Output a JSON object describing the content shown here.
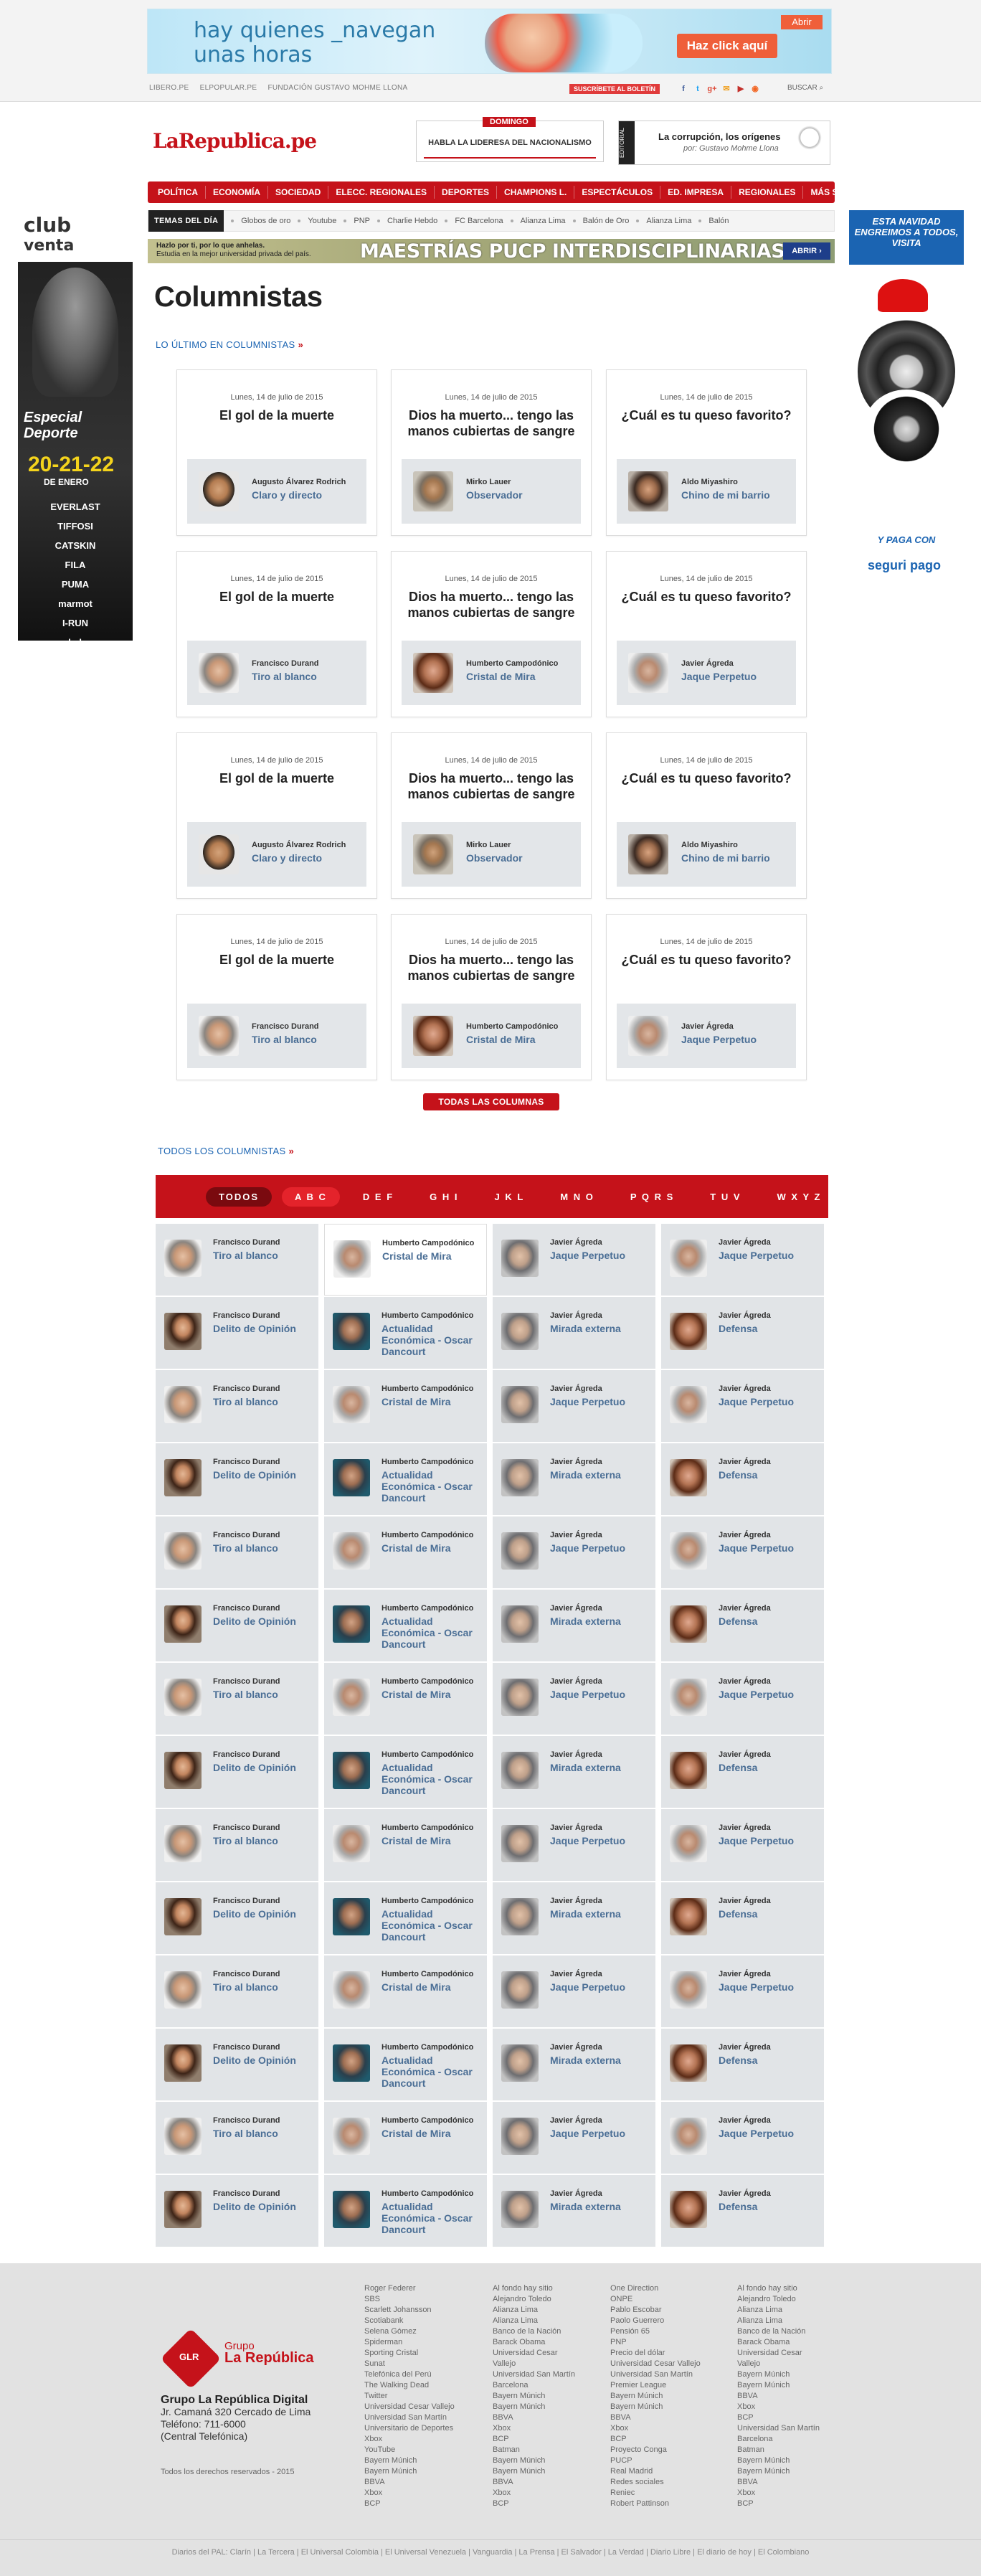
{
  "ad_top": {
    "line1": "hay quienes _navegan",
    "line2": "unas horas",
    "cta": "Haz click aquí",
    "open": "Abrir"
  },
  "top_links": [
    "LIBERO.PE",
    "ELPOPULAR.PE",
    "FUNDACIÓN GUSTAVO MOHME LLONA"
  ],
  "subscribe": "SUSCRÍBETE AL BOLETÍN",
  "search": "BUSCAR",
  "logo": "LaRepublica.pe",
  "domingo": {
    "tag": "DOMINGO",
    "text": "HABLA LA LIDERESA DEL NACIONALISMO"
  },
  "promo": {
    "side": "EDITORIAL",
    "title": "La corrupción, los orígenes",
    "subtitle": "por: Gustavo Mohme Llona"
  },
  "nav": [
    "POLÍTICA",
    "ECONOMÍA",
    "SOCIEDAD",
    "ELECC. REGIONALES",
    "DEPORTES",
    "CHAMPIONS L.",
    "ESPECTÁCULOS",
    "ED. IMPRESA",
    "REGIONALES",
    "MÁS SECCIONES ›"
  ],
  "temas": {
    "label": "TEMAS DEL DÍA",
    "items": [
      "Globos de oro",
      "Youtube",
      "PNP",
      "Charlie Hebdo",
      "FC Barcelona",
      "Alianza Lima",
      "Balón de Oro",
      "Alianza Lima",
      "Balón"
    ]
  },
  "maestrias": {
    "small1": "Hazlo por ti, por lo que anhelas.",
    "small2": "Estudia en la mejor universidad privada del país.",
    "big": "MAESTRÍAS PUCP INTERDISCIPLINARIAS",
    "btn": "ABRIR ›"
  },
  "ad_left": {
    "club": "club",
    "venta": "venta",
    "esp1": "Especial",
    "esp2": "Deporte",
    "date": "20-21-22",
    "ene": "DE ENERO",
    "brands": [
      "EVERLAST",
      "TIFFOSI",
      "CATSKIN",
      "FILA",
      "PUMA",
      "marmot",
      "I-RUN",
      "new balance"
    ]
  },
  "ad_right": {
    "head": "ESTA NAVIDAD ENGREIMOS A TODOS, VISITA",
    "pay": "Y PAGA CON",
    "brand": "seguri pago"
  },
  "page_title": "Columnistas",
  "latest_label": "LO ÚLTIMO EN COLUMNISTAS",
  "all_label": "TODOS LOS COLUMNISTAS",
  "all_columns_btn": "TODAS LAS COLUMNAS",
  "latest": [
    {
      "date": "Lunes, 14 de julio de 2015",
      "title": "El gol de la muerte",
      "author": "Augusto Álvarez Rodrich",
      "column": "Claro y directo"
    },
    {
      "date": "Lunes, 14 de julio de 2015",
      "title": "Dios ha muerto... tengo las manos cubiertas de sangre",
      "author": "Mirko Lauer",
      "column": "Observador"
    },
    {
      "date": "Lunes, 14 de julio de 2015",
      "title": "¿Cuál es tu queso favorito?",
      "author": "Aldo Miyashiro",
      "column": "Chino de mi barrio"
    },
    {
      "date": "Lunes, 14 de julio de 2015",
      "title": "El gol de la muerte",
      "author": "Francisco Durand",
      "column": "Tiro al blanco"
    },
    {
      "date": "Lunes, 14 de julio de 2015",
      "title": "Dios ha muerto... tengo las manos cubiertas de sangre",
      "author": "Humberto Campodónico",
      "column": "Cristal de Mira"
    },
    {
      "date": "Lunes, 14 de julio de 2015",
      "title": "¿Cuál es tu queso favorito?",
      "author": "Javier Ágreda",
      "column": "Jaque Perpetuo"
    },
    {
      "date": "Lunes, 14 de julio de 2015",
      "title": "El gol de la muerte",
      "author": "Augusto Álvarez Rodrich",
      "column": "Claro y directo"
    },
    {
      "date": "Lunes, 14 de julio de 2015",
      "title": "Dios ha muerto... tengo las manos cubiertas de sangre",
      "author": "Mirko Lauer",
      "column": "Observador"
    },
    {
      "date": "Lunes, 14 de julio de 2015",
      "title": "¿Cuál es tu queso favorito?",
      "author": "Aldo Miyashiro",
      "column": "Chino de mi barrio"
    },
    {
      "date": "Lunes, 14 de julio de 2015",
      "title": "El gol de la muerte",
      "author": "Francisco Durand",
      "column": "Tiro al blanco"
    },
    {
      "date": "Lunes, 14 de julio de 2015",
      "title": "Dios ha muerto... tengo las manos cubiertas de sangre",
      "author": "Humberto Campodónico",
      "column": "Cristal de Mira"
    },
    {
      "date": "Lunes, 14 de julio de 2015",
      "title": "¿Cuál es tu queso favorito?",
      "author": "Javier Ágreda",
      "column": "Jaque Perpetuo"
    }
  ],
  "alphabet": [
    "TODOS",
    "A B C",
    "D E F",
    "G H I",
    "J K L",
    "M N O",
    "P Q R S",
    "T U V",
    "W X Y Z"
  ],
  "row_a": [
    {
      "author": "Francisco Durand",
      "column": "Tiro al blanco"
    },
    {
      "author": "Humberto Campodónico",
      "column": "Cristal de Mira"
    },
    {
      "author": "Javier Ágreda",
      "column": "Jaque Perpetuo"
    },
    {
      "author": "Javier Ágreda",
      "column": "Jaque Perpetuo"
    }
  ],
  "row_b": [
    {
      "author": "Francisco Durand",
      "column": "Delito de Opinión"
    },
    {
      "author": "Humberto Campodónico",
      "column": "Actualidad Económica - Oscar Dancourt"
    },
    {
      "author": "Javier Ágreda",
      "column": "Mirada externa"
    },
    {
      "author": "Javier Ágreda",
      "column": "Defensa"
    }
  ],
  "footer": {
    "group": "Grupo",
    "group_name": "La República",
    "company": "Grupo La República Digital",
    "address": "Jr. Camaná 320 Cercado de Lima",
    "phone": "Teléfono: 711-6000",
    "phone2": "(Central Telefónica)",
    "rights": "Todos los derechos reservados - 2015",
    "col1": [
      "Roger Federer",
      "SBS",
      "Scarlett Johansson",
      "Scotiabank",
      "Selena Gómez",
      "Spiderman",
      "Sporting Cristal",
      "Sunat",
      "Telefónica del Perú",
      "The Walking Dead",
      "Twitter",
      "Universidad Cesar Vallejo",
      "Universidad San Martín",
      "Universitario de Deportes",
      "Xbox",
      "YouTube",
      "Bayern Múnich",
      "Bayern Múnich",
      "BBVA",
      "Xbox",
      "BCP"
    ],
    "col2": [
      "Al fondo hay sitio",
      "Alejandro Toledo",
      "Alianza Lima",
      "Alianza Lima",
      "Banco de la Nación",
      "Barack Obama",
      "Universidad Cesar",
      "Vallejo",
      "Universidad San Martín",
      "Barcelona",
      "Bayern Múnich",
      "Bayern Múnich",
      "BBVA",
      "Xbox",
      "BCP",
      "Batman",
      "Bayern Múnich",
      "Bayern Múnich",
      "BBVA",
      "Xbox",
      "BCP"
    ],
    "col3": [
      "One Direction",
      "ONPE",
      "Pablo Escobar",
      "Paolo Guerrero",
      "Pensión 65",
      "PNP",
      "Precio del dólar",
      "Universidad Cesar Vallejo",
      "Universidad San Martín",
      "Premier League",
      "Bayern Múnich",
      "Bayern Múnich",
      "BBVA",
      "Xbox",
      "BCP",
      "Proyecto Conga",
      "PUCP",
      "Real Madrid",
      "Redes sociales",
      "Reniec",
      "Robert Pattinson"
    ],
    "col4": [
      "Al fondo hay sitio",
      "Alejandro Toledo",
      "Alianza Lima",
      "Alianza Lima",
      "Banco de la Nación",
      "Barack Obama",
      "Universidad Cesar",
      "Vallejo",
      "Bayern Múnich",
      "Bayern Múnich",
      "BBVA",
      "Xbox",
      "BCP",
      "Universidad San Martín",
      "Barcelona",
      "Batman",
      "Bayern Múnich",
      "Bayern Múnich",
      "BBVA",
      "Xbox",
      "BCP"
    ],
    "bottom": "Diarios del PAL: Clarín | La Tercera | El Universal Colombia | El Universal Venezuela | Vanguardia | La Prensa | El Salvador | La Verdad | Diario Libre | El diario de hoy | El Colombiano"
  }
}
